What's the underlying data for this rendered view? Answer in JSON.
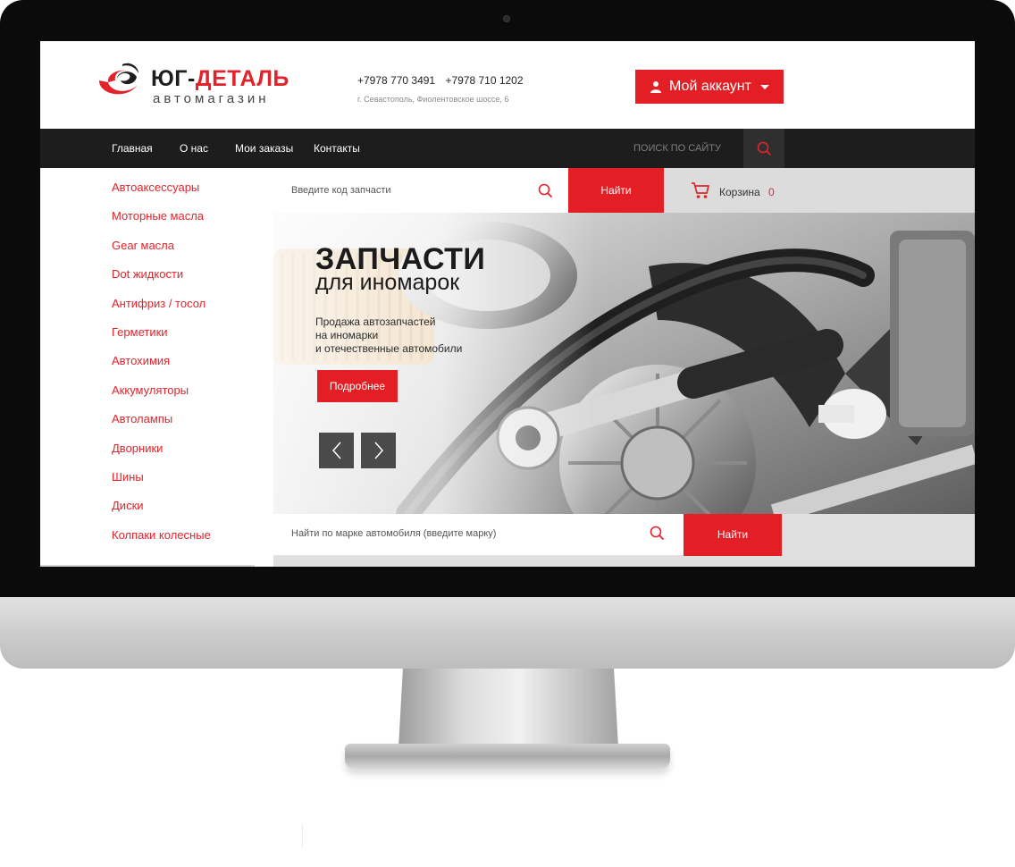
{
  "header": {
    "logo_title_part1": "ЮГ-",
    "logo_title_part2": "ДЕТАЛЬ",
    "logo_subtitle": "автомагазин",
    "phone_1": "+7978 770 3491",
    "phone_2": "+7978 710 1202",
    "address": "г. Севастополь, Фиолентовское шоссе, 6",
    "account_button": "Мой аккаунт"
  },
  "nav": {
    "items": [
      "Главная",
      "О нас",
      "Мои заказы",
      "Контакты"
    ],
    "search_placeholder": "ПОИСК ПО САЙТУ"
  },
  "sidebar": {
    "categories": [
      "Автоаксессуары",
      "Моторные масла",
      "Gear масла",
      "Dot жидкости",
      "Антифриз / тосол",
      "Герметики",
      "Автохимия",
      "Аккумуляторы",
      "Автолампы",
      "Дворники",
      "Шины",
      "Диски",
      "Колпаки колесные"
    ]
  },
  "part_search": {
    "placeholder": "Введите код запчасти",
    "button": "Найти"
  },
  "cart": {
    "label": "Корзина",
    "count": "0"
  },
  "banner": {
    "title": "ЗАПЧАСТИ",
    "subtitle": "для иномарок",
    "text_lines": [
      "Продажа автозапчастей",
      "на иномарки",
      "и отечественные автомобили"
    ],
    "button": "Подробнее"
  },
  "brand_search": {
    "placeholder": "Найти по марке автомобиля (введите марку)",
    "button": "Найти"
  },
  "colors": {
    "accent": "#e31e24",
    "nav_bg": "#1d1d1d",
    "bezel": "#0b0b0b"
  }
}
